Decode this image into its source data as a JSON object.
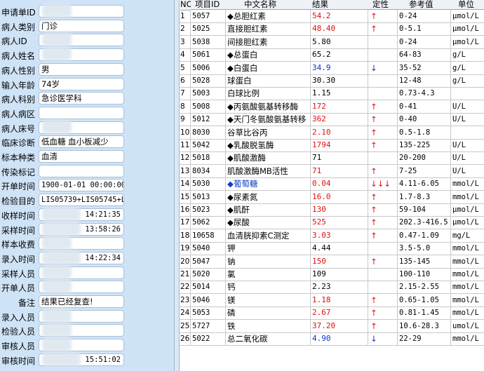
{
  "form": {
    "fields": [
      {
        "label": "申请单ID",
        "value": "",
        "blur": true
      },
      {
        "label": "病人类别",
        "value": "门诊"
      },
      {
        "label": "病人ID",
        "value": "",
        "blur": true
      },
      {
        "label": "病人姓名",
        "value": "",
        "blur": true
      },
      {
        "label": "病人性别",
        "value": "男"
      },
      {
        "label": "输入年龄",
        "value": "74岁"
      },
      {
        "label": "病人科别",
        "value": "急诊医学科"
      },
      {
        "label": "病人病区",
        "value": ""
      },
      {
        "label": "病人床号",
        "value": "",
        "blur": true
      },
      {
        "label": "临床诊断",
        "value": "低血糖  血小板减少"
      },
      {
        "label": "标本种类",
        "value": "血清"
      },
      {
        "label": "传染标记",
        "value": ""
      },
      {
        "label": "开单时间",
        "value": "1900-01-01 00:00:00",
        "mono": true
      },
      {
        "label": "检验目的",
        "value": "LIS05739+LIS05745+LI",
        "mono": true
      },
      {
        "label": "收样时间",
        "value": "14:21:35",
        "mono": true,
        "right": true,
        "blur": true
      },
      {
        "label": "采样时间",
        "value": "13:58:26",
        "mono": true,
        "right": true,
        "blur": true
      },
      {
        "label": "样本收费",
        "value": "",
        "blur": true
      },
      {
        "label": "录入时间",
        "value": "14:22:34",
        "mono": true,
        "right": true,
        "blur": true
      },
      {
        "label": "采样人员",
        "value": "",
        "blur": true
      },
      {
        "label": "开单人员",
        "value": "",
        "blur": true
      },
      {
        "label": "备注",
        "value": "结果已经复查!"
      },
      {
        "label": "录入人员",
        "value": "",
        "blur": true
      },
      {
        "label": "检验人员",
        "value": "",
        "blur": true
      },
      {
        "label": "审核人员",
        "value": "",
        "blur": true
      },
      {
        "label": "审核时间",
        "value": "15:51:02",
        "mono": true,
        "right": true,
        "blur": true
      }
    ]
  },
  "grid": {
    "headers": {
      "no": "NO",
      "code": "项目ID",
      "name": "中文名称",
      "result": "结果",
      "flag": "定性",
      "ref": "参考值",
      "unit": "单位"
    },
    "colors": {
      "high": "#e01010",
      "low": "#1030d0",
      "normal": "#000000",
      "selected": "#1040c0"
    },
    "rows": [
      {
        "no": "1",
        "code": "5057",
        "name": "◆总胆红素",
        "result": "54.2",
        "flag": "↑",
        "ref": "0-24",
        "unit": "μmol/L",
        "level": "high"
      },
      {
        "no": "2",
        "code": "5025",
        "name": "直接胆红素",
        "result": "48.40",
        "flag": "↑",
        "ref": "0-5.1",
        "unit": "μmol/L",
        "level": "high"
      },
      {
        "no": "3",
        "code": "5038",
        "name": "间接胆红素",
        "result": "5.80",
        "flag": "",
        "ref": "0-24",
        "unit": "μmol/L",
        "level": "normal"
      },
      {
        "no": "4",
        "code": "5061",
        "name": "◆总蛋白",
        "result": "65.2",
        "flag": "",
        "ref": "64-83",
        "unit": "g/L",
        "level": "normal"
      },
      {
        "no": "5",
        "code": "5006",
        "name": "◆白蛋白",
        "result": "34.9",
        "flag": "↓",
        "ref": "35-52",
        "unit": "g/L",
        "level": "low"
      },
      {
        "no": "6",
        "code": "5028",
        "name": "球蛋白",
        "result": "30.30",
        "flag": "",
        "ref": "12-48",
        "unit": "g/L",
        "level": "normal"
      },
      {
        "no": "7",
        "code": "5003",
        "name": "白球比例",
        "result": "1.15",
        "flag": "",
        "ref": "0.73-4.3",
        "unit": "",
        "level": "normal"
      },
      {
        "no": "8",
        "code": "5008",
        "name": "◆丙氨酸氨基转移酶",
        "result": "172",
        "flag": "↑",
        "ref": "0-41",
        "unit": "U/L",
        "level": "high"
      },
      {
        "no": "9",
        "code": "5012",
        "name": "◆天门冬氨酸氨基转移",
        "result": "362",
        "flag": "↑",
        "ref": "0-40",
        "unit": "U/L",
        "level": "high"
      },
      {
        "no": "10",
        "code": "8030",
        "name": "谷草比谷丙",
        "result": "2.10",
        "flag": "↑",
        "ref": "0.5-1.8",
        "unit": "",
        "level": "high"
      },
      {
        "no": "11",
        "code": "5042",
        "name": "◆乳酸脱氢酶",
        "result": "1794",
        "flag": "↑",
        "ref": "135-225",
        "unit": "U/L",
        "level": "high"
      },
      {
        "no": "12",
        "code": "5018",
        "name": "◆肌酸激酶",
        "result": "71",
        "flag": "",
        "ref": "20-200",
        "unit": "U/L",
        "level": "normal"
      },
      {
        "no": "13",
        "code": "8034",
        "name": "肌酸激酶MB活性",
        "result": "71",
        "flag": "↑",
        "ref": "7-25",
        "unit": "U/L",
        "level": "high"
      },
      {
        "no": "14",
        "code": "5030",
        "name": "◆葡萄糖",
        "result": "0.04",
        "flag": "↓↓↓",
        "ref": "4.11-6.05",
        "unit": "mmol/L",
        "level": "high",
        "selected": true
      },
      {
        "no": "15",
        "code": "5013",
        "name": "◆尿素氮",
        "result": "16.0",
        "flag": "↑",
        "ref": "1.7-8.3",
        "unit": "mmol/L",
        "level": "high"
      },
      {
        "no": "16",
        "code": "5023",
        "name": "◆肌酐",
        "result": "130",
        "flag": "↑",
        "ref": "59-104",
        "unit": "μmol/L",
        "level": "high"
      },
      {
        "no": "17",
        "code": "5062",
        "name": "◆尿酸",
        "result": "525",
        "flag": "↑",
        "ref": "202.3-416.5",
        "unit": "μmol/L",
        "level": "high"
      },
      {
        "no": "18",
        "code": "10658",
        "name": "血清胱抑素C测定",
        "result": "3.03",
        "flag": "↑",
        "ref": "0.47-1.09",
        "unit": "mg/L",
        "level": "high"
      },
      {
        "no": "19",
        "code": "5040",
        "name": "钾",
        "result": "4.44",
        "flag": "",
        "ref": "3.5-5.0",
        "unit": "mmol/L",
        "level": "normal"
      },
      {
        "no": "20",
        "code": "5047",
        "name": "钠",
        "result": "150",
        "flag": "↑",
        "ref": "135-145",
        "unit": "mmol/L",
        "level": "high"
      },
      {
        "no": "21",
        "code": "5020",
        "name": "氯",
        "result": "109",
        "flag": "",
        "ref": "100-110",
        "unit": "mmol/L",
        "level": "normal"
      },
      {
        "no": "22",
        "code": "5014",
        "name": "钙",
        "result": "2.23",
        "flag": "",
        "ref": "2.15-2.55",
        "unit": "mmol/L",
        "level": "normal"
      },
      {
        "no": "23",
        "code": "5046",
        "name": "镁",
        "result": "1.18",
        "flag": "↑",
        "ref": "0.65-1.05",
        "unit": "mmol/L",
        "level": "high"
      },
      {
        "no": "24",
        "code": "5053",
        "name": "磷",
        "result": "2.67",
        "flag": "↑",
        "ref": "0.81-1.45",
        "unit": "mmol/L",
        "level": "high"
      },
      {
        "no": "25",
        "code": "5727",
        "name": "铁",
        "result": "37.20",
        "flag": "↑",
        "ref": "10.6-28.3",
        "unit": "umol/L",
        "level": "high"
      },
      {
        "no": "26",
        "code": "5022",
        "name": "总二氧化碳",
        "result": "4.90",
        "flag": "↓",
        "ref": "22-29",
        "unit": "mmol/L",
        "level": "low"
      }
    ]
  }
}
